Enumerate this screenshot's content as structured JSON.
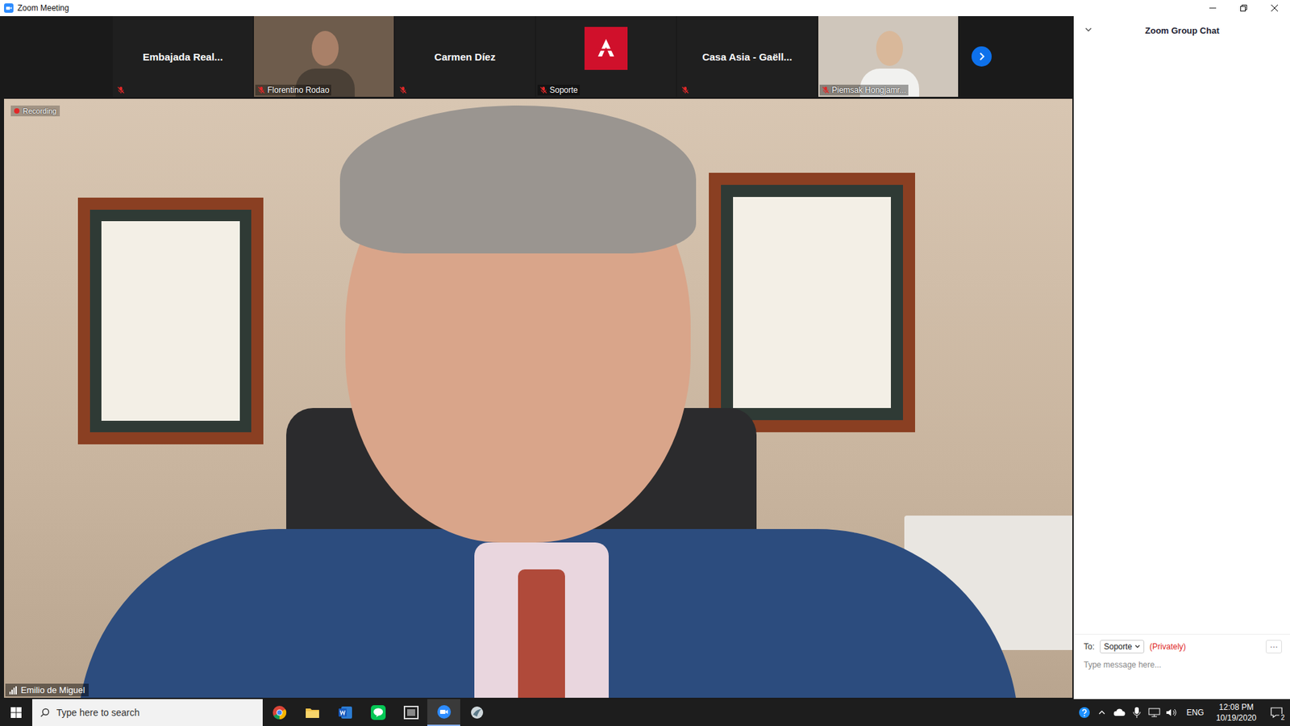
{
  "window": {
    "title": "Zoom Meeting"
  },
  "participants": [
    {
      "name": "Embajada  Real...",
      "kind": "name",
      "muted": true
    },
    {
      "name": "Florentino Rodao",
      "kind": "video",
      "muted": true
    },
    {
      "name": "Carmen Díez",
      "kind": "name",
      "muted": true
    },
    {
      "name": "Soporte",
      "kind": "avatar",
      "muted": true
    },
    {
      "name": "Casa Asia - Gaëll...",
      "kind": "name",
      "muted": true
    },
    {
      "name": "Piemsak Hongjamr...",
      "kind": "video",
      "muted": true
    }
  ],
  "recording": {
    "label": "Recording",
    "on": true
  },
  "speaker": {
    "name": "Emilio de Miguel"
  },
  "chat": {
    "title": "Zoom Group Chat",
    "to_label": "To:",
    "recipient": "Soporte",
    "privacy": "(Privately)",
    "more": "···",
    "placeholder": "Type message here..."
  },
  "taskbar": {
    "search_placeholder": "Type here to search",
    "language": "ENG",
    "time": "12:08 PM",
    "date": "10/19/2020",
    "notifications": "2",
    "active_app": "zoom"
  }
}
